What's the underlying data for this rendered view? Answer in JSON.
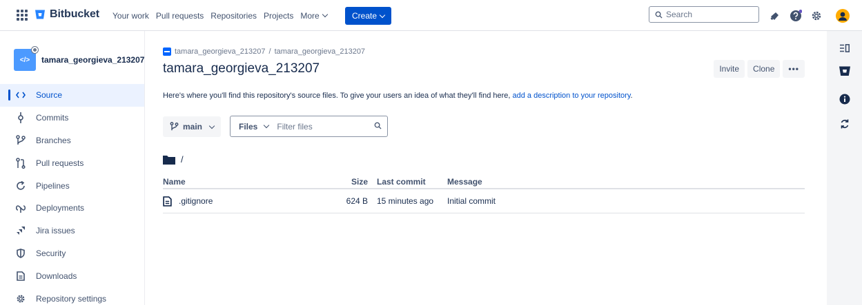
{
  "topnav": {
    "product": "Bitbucket",
    "links": [
      "Your work",
      "Pull requests",
      "Repositories",
      "Projects",
      "More"
    ],
    "create_label": "Create",
    "search_placeholder": "Search"
  },
  "sidebar": {
    "repo_name": "tamara_georgieva_213207",
    "repo_avatar_glyph": "</>",
    "items": [
      {
        "label": "Source",
        "icon": "code-icon",
        "active": true
      },
      {
        "label": "Commits",
        "icon": "commit-icon"
      },
      {
        "label": "Branches",
        "icon": "branch-icon"
      },
      {
        "label": "Pull requests",
        "icon": "pull-request-icon"
      },
      {
        "label": "Pipelines",
        "icon": "pipelines-icon"
      },
      {
        "label": "Deployments",
        "icon": "deployments-icon"
      },
      {
        "label": "Jira issues",
        "icon": "jira-icon"
      },
      {
        "label": "Security",
        "icon": "shield-icon"
      },
      {
        "label": "Downloads",
        "icon": "downloads-icon"
      },
      {
        "label": "Repository settings",
        "icon": "gear-icon"
      }
    ]
  },
  "main": {
    "breadcrumb": {
      "workspace": "tamara_georgieva_213207",
      "separator": "/",
      "repo": "tamara_georgieva_213207"
    },
    "title": "tamara_georgieva_213207",
    "actions": {
      "invite": "Invite",
      "clone": "Clone",
      "more": "•••"
    },
    "description_text": "Here's where you'll find this repository's source files. To give your users an idea of what they'll find here, ",
    "description_link": "add a description to your repository",
    "description_end": ".",
    "branch": "main",
    "files_dropdown": "Files",
    "filter_placeholder": "Filter files",
    "path": "/",
    "table": {
      "headers": {
        "name": "Name",
        "size": "Size",
        "last_commit": "Last commit",
        "message": "Message"
      },
      "rows": [
        {
          "name": ".gitignore",
          "size": "624 B",
          "last_commit": "15 minutes ago",
          "message": "Initial commit"
        }
      ]
    }
  },
  "colors": {
    "brand": "#0052cc",
    "text": "#172b4d",
    "muted": "#42526e",
    "notify_dot": "#6554c0",
    "avatar": "#ffab00"
  }
}
